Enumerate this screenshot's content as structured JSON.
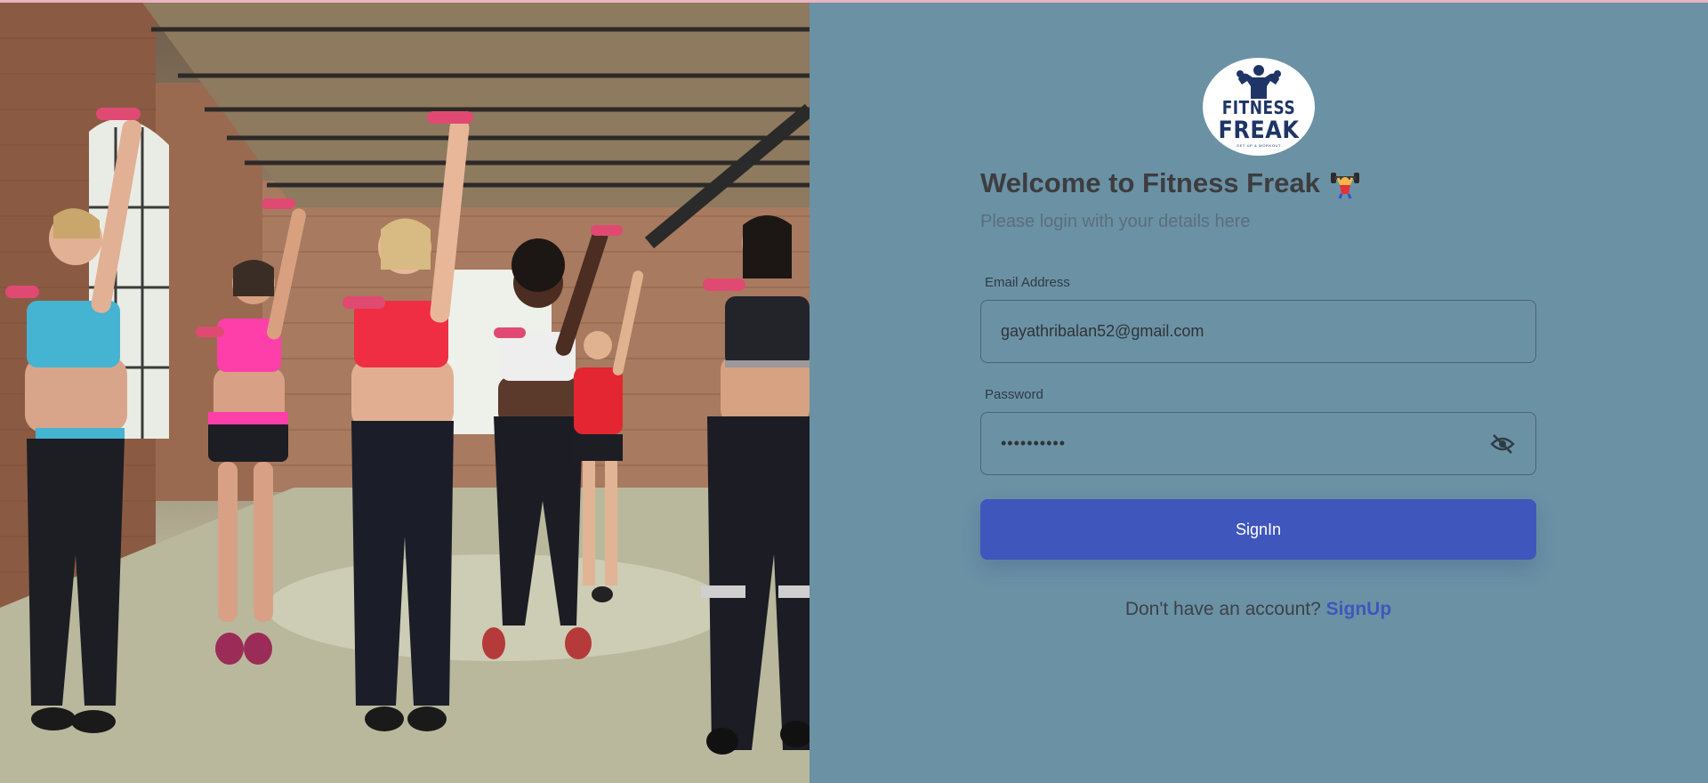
{
  "colors": {
    "panel_bg": "#6b91a5",
    "primary": "#3f56bc",
    "heading": "#3d3d3f",
    "logo_navy": "#1e3566"
  },
  "hero": {
    "image_alt": "Women exercising with pink dumbbells in a brick-walled gym"
  },
  "logo": {
    "word1": "FITNESS",
    "word2": "FREAK",
    "tagline": "GET UP & WORKOUT",
    "icon": "bodybuilder-icon"
  },
  "login": {
    "title": "Welcome to Fitness Freak",
    "title_emoji_icon": "weightlifter-icon",
    "subtitle": "Please login with your details here",
    "email_label": "Email Address",
    "email_value": "gayathribalan52@gmail.com",
    "password_label": "Password",
    "password_value": "••••••••••",
    "password_toggle_icon": "eye-off-icon",
    "signin_label": "SignIn",
    "footer_text": "Don't have an account?",
    "signup_label": "SignUp"
  }
}
